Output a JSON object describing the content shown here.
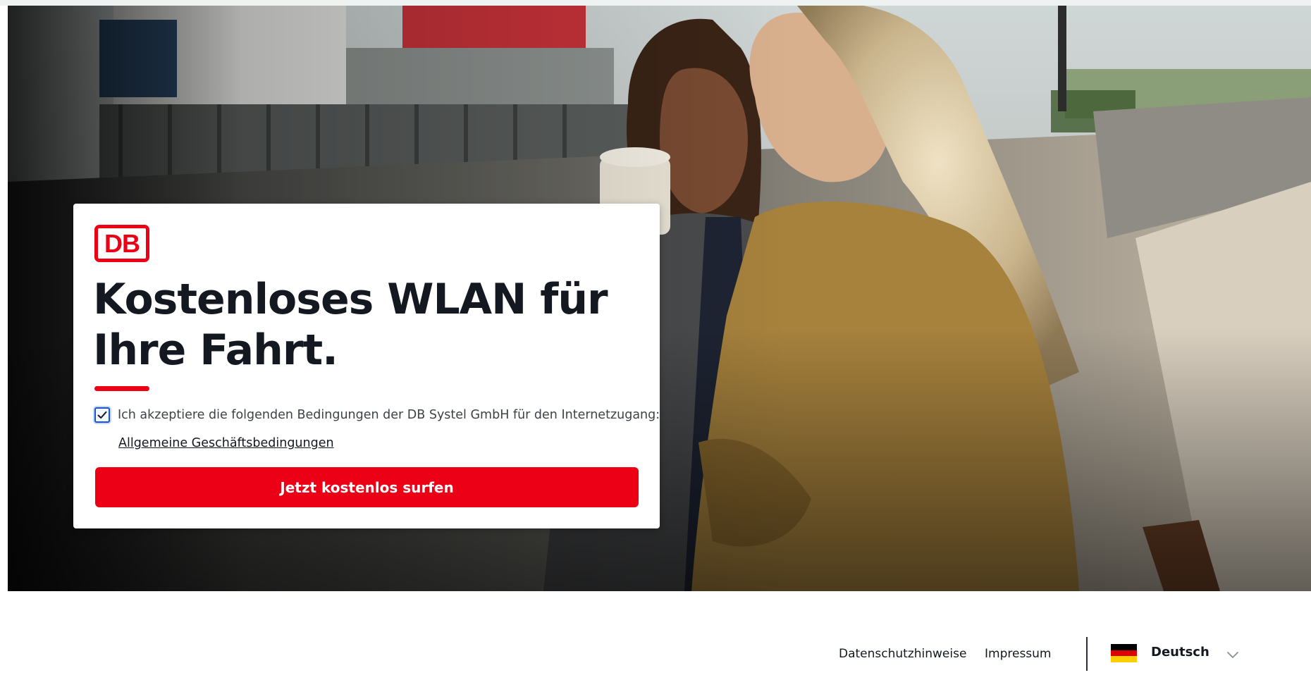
{
  "card": {
    "logo_text": "DB",
    "headline_line1": "Kostenloses WLAN für",
    "headline_line2": "Ihre Fahrt.",
    "consent_checked": true,
    "consent_text": "Ich akzeptiere die folgenden Bedingungen der DB Systel GmbH für den Internetzugang:",
    "terms_link": "Allgemeine Geschäftsbedingungen",
    "cta_label": "Jetzt kostenlos surfen"
  },
  "footer": {
    "privacy_link": "Datenschutzhinweise",
    "imprint_link": "Impressum",
    "language": {
      "selected": "Deutsch",
      "flag_colors": [
        "#000000",
        "#dd0000",
        "#ffce00"
      ]
    }
  },
  "colors": {
    "brand_red": "#ec0016",
    "text_dark": "#131821",
    "focus_blue": "#1a56c4"
  },
  "icons": {
    "logo": "db-logo",
    "checkbox": "checkmark-icon",
    "flag": "germany-flag-icon",
    "dropdown": "chevron-down-icon"
  }
}
